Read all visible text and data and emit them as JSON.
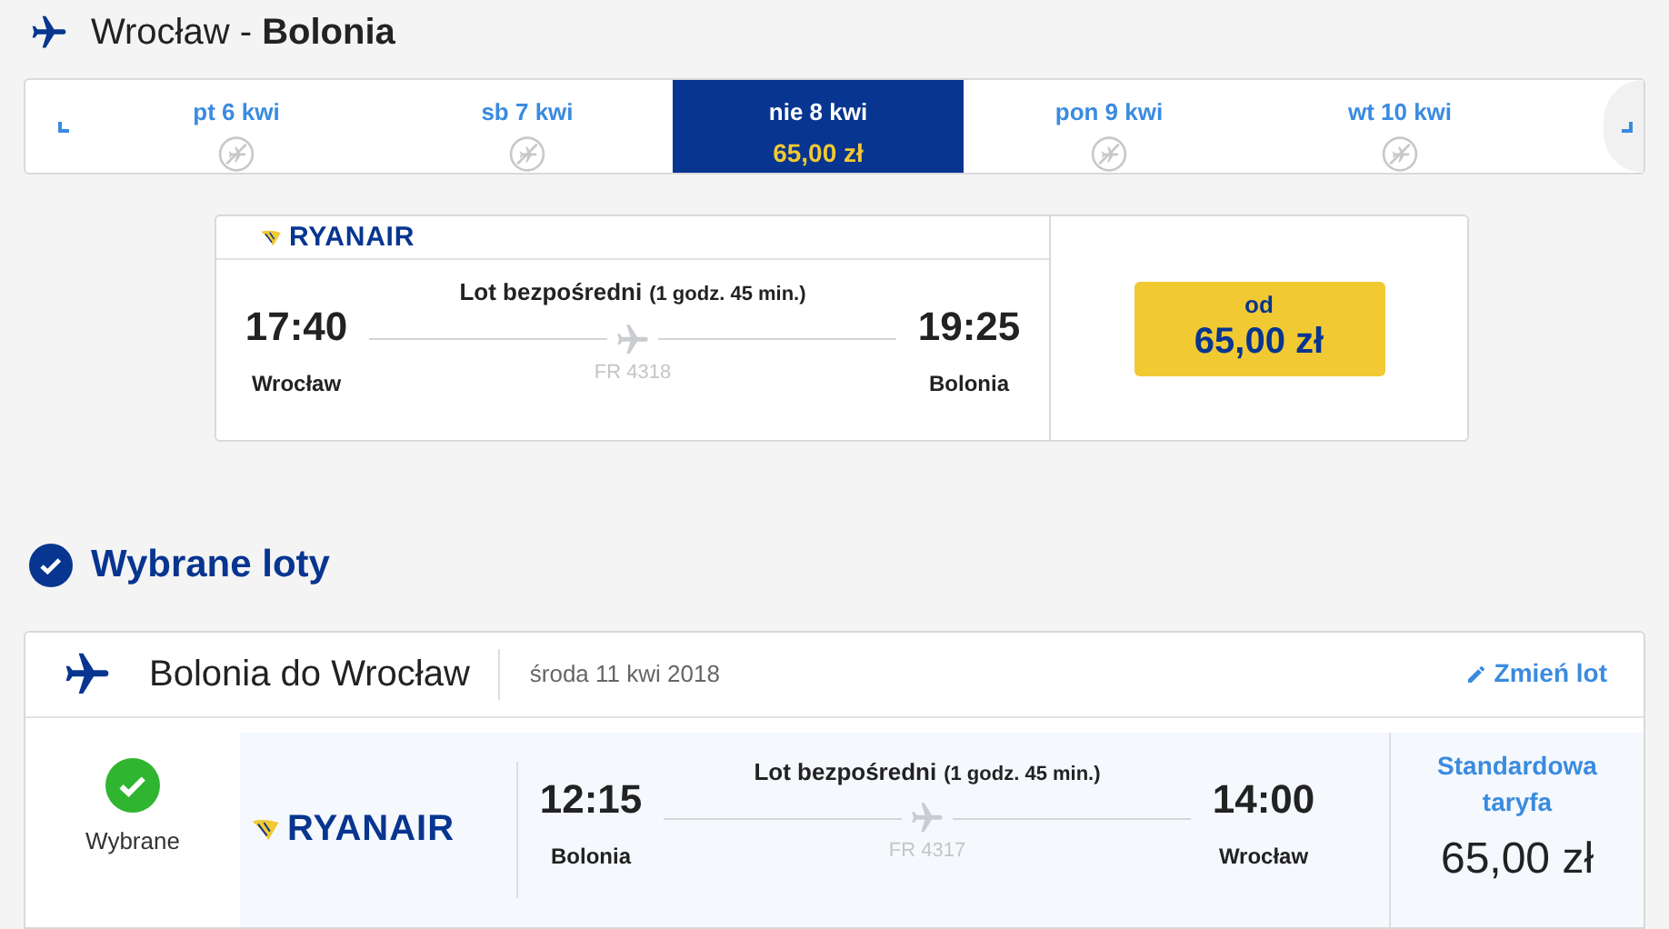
{
  "route": {
    "from": "Wrocław - ",
    "to": "Bolonia"
  },
  "dates": [
    {
      "label": "pt 6 kwi",
      "selected": false
    },
    {
      "label": "sb 7 kwi",
      "selected": false
    },
    {
      "label": "nie 8 kwi",
      "selected": true,
      "price": "65,00 zł"
    },
    {
      "label": "pon 9 kwi",
      "selected": false
    },
    {
      "label": "wt 10 kwi",
      "selected": false
    }
  ],
  "flight": {
    "airline": "RYANAIR",
    "type": "Lot bezpośredni",
    "duration": "(1 godz. 45 min.)",
    "depart": "17:40",
    "arrive": "19:25",
    "number": "FR 4318",
    "from": "Wrocław",
    "to": "Bolonia",
    "price_prefix": "od",
    "price": "65,00 zł"
  },
  "selected_section": {
    "title": "Wybrane loty"
  },
  "selected_flight": {
    "title": "Bolonia do Wrocław",
    "date": "środa 11 kwi 2018",
    "change": "Zmień lot",
    "status": "Wybrane",
    "airline": "RYANAIR",
    "type": "Lot bezpośredni",
    "duration": "(1 godz. 45 min.)",
    "depart": "12:15",
    "arrive": "14:00",
    "number": "FR 4317",
    "from": "Bolonia",
    "to": "Wrocław",
    "fare": "Standardowa taryfa",
    "price": "65,00 zł"
  }
}
